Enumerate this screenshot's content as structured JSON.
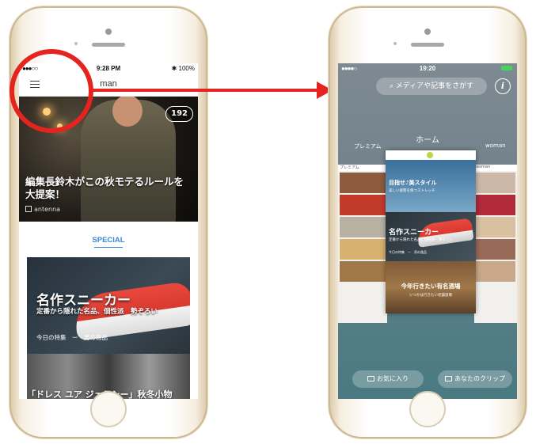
{
  "left_phone": {
    "status": {
      "signal": "●●●○○",
      "time": "9:28 PM",
      "battery": "✱ 100%"
    },
    "nav_title": "man",
    "hero": {
      "count": "192",
      "title": "編集長鈴木がこの秋モテるルールを大提案！",
      "source": "antenna"
    },
    "section_label": "SPECIAL",
    "feature": {
      "title": "名作スニーカー",
      "subtitle": "定番から隠れた名品、個性派　勢ぞろい",
      "tag": "今日の特集　ー　男の逸品"
    },
    "strip_title": "「ドレス ユア ジェラシー」秋冬小物"
  },
  "right_phone": {
    "status": {
      "signal": "●●●●○",
      "time": "19:20"
    },
    "search_placeholder": "メディアや記事をさがす",
    "info_label": "i",
    "tabs": {
      "left": "プレミアム",
      "center": "ホーム",
      "right": "woman"
    },
    "side_left_label": "プレミアム",
    "side_right_label": "woman",
    "card": {
      "section_a_title": "目指せ♪美スタイル",
      "section_a_sub": "美しい姿勢を保つストレッチ",
      "section_b_title": "名作スニーカー",
      "section_b_sub": "定番から隠れた名品、個性派　勢ぞろい",
      "section_b_tag": "今日の特集　ー　男の逸品",
      "section_c_title": "今年行きたい有名酒場",
      "section_c_sub": "いつかは行きたい老舗酒場"
    },
    "buttons": {
      "favorites": "お気に入り",
      "clips": "あなたのクリップ"
    }
  },
  "colors": {
    "highlight": "#e5231f",
    "accent": "#3a86d8",
    "battery": "#47d35c"
  }
}
